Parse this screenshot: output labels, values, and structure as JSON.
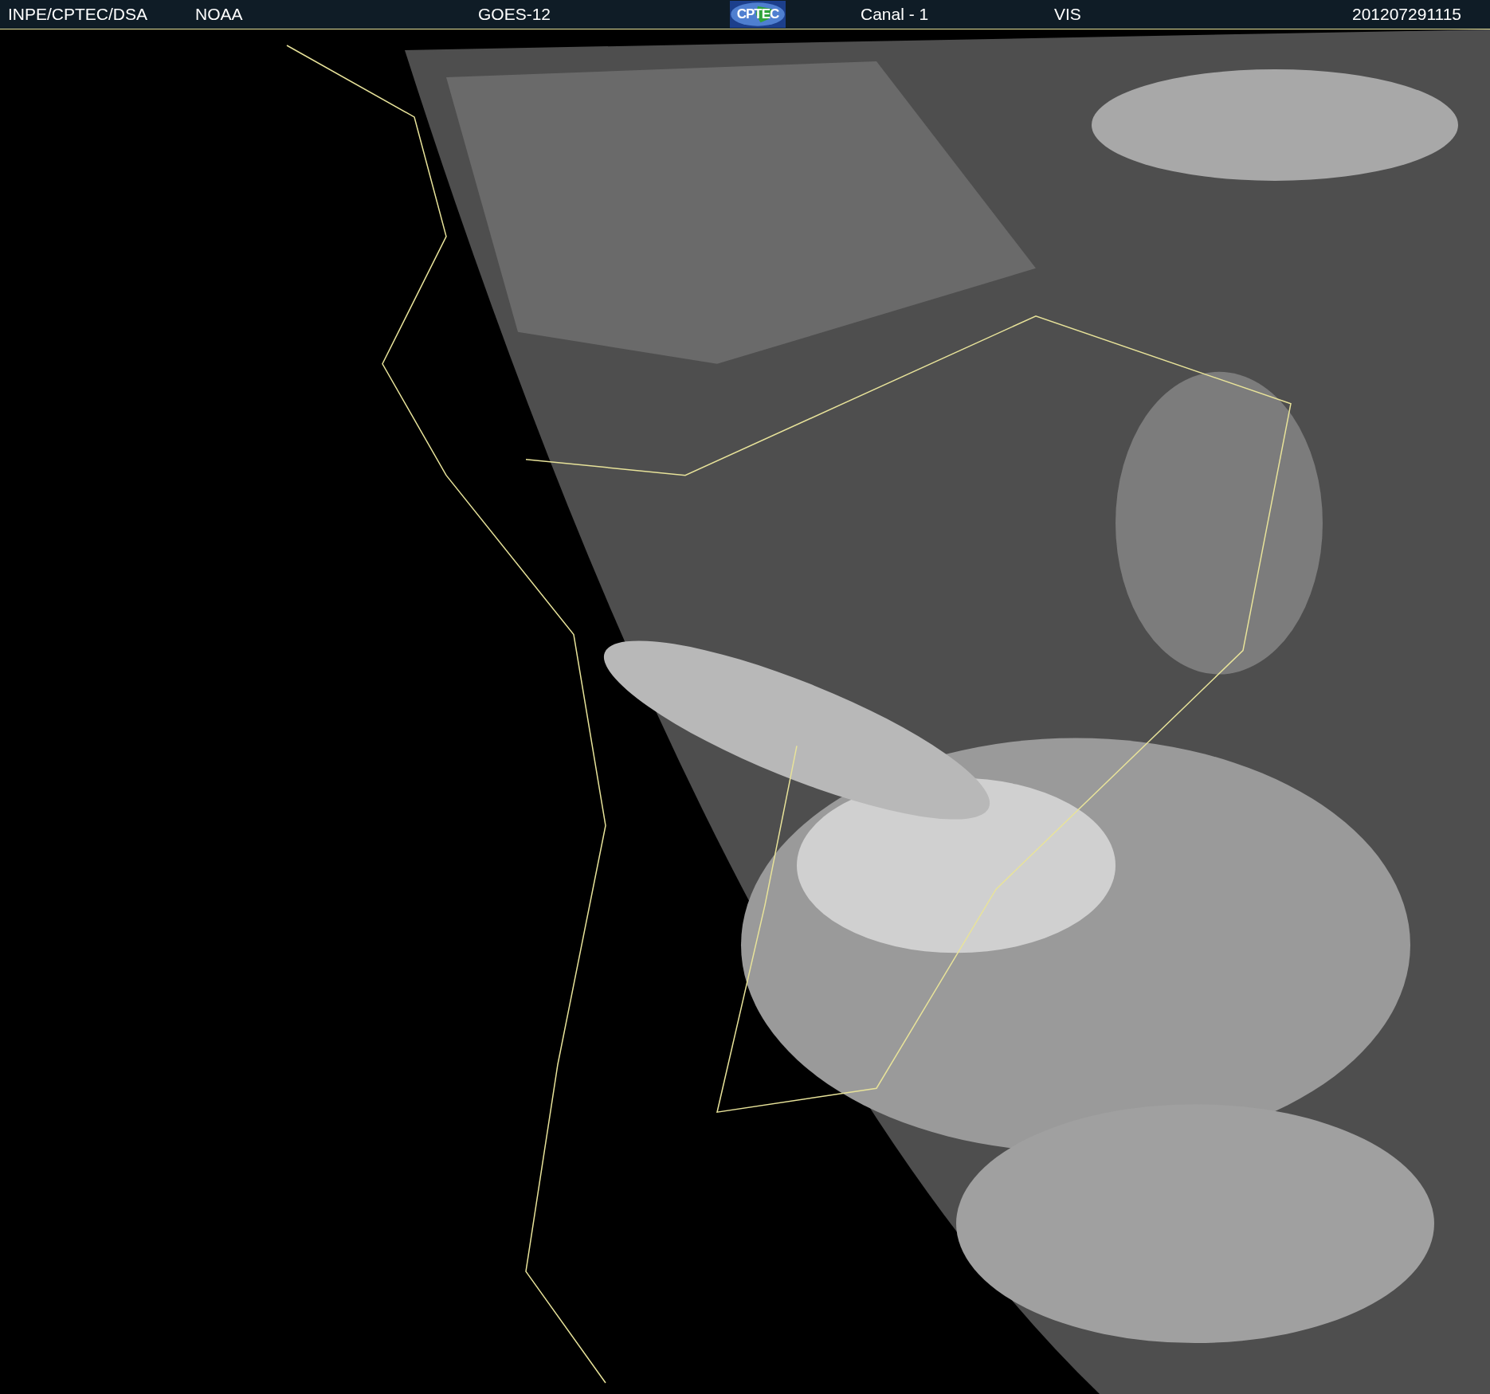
{
  "header": {
    "items": [
      {
        "kind": "text",
        "text": "INPE/CPTEC/DSA"
      },
      {
        "kind": "text",
        "text": "NOAA"
      },
      {
        "kind": "text",
        "text": "GOES-12"
      },
      {
        "kind": "logo",
        "text": "CPTEC"
      },
      {
        "kind": "text",
        "text": "Canal - 1"
      },
      {
        "kind": "text",
        "text": "VIS"
      },
      {
        "kind": "text",
        "text": "201207291115"
      }
    ]
  }
}
